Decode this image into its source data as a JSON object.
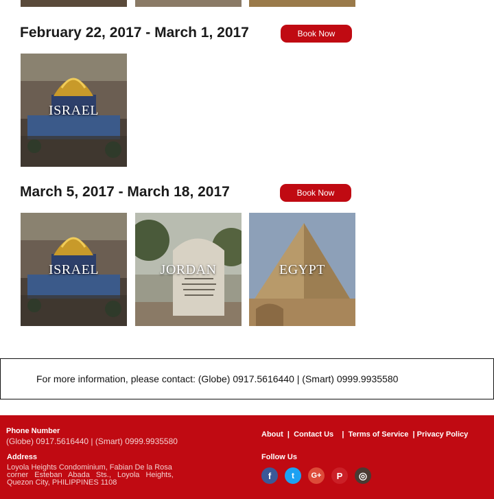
{
  "trips": [
    {
      "dates": "February 22, 2017 - March 1, 2017",
      "button": "Book Now",
      "destinations": [
        "ISRAEL"
      ]
    },
    {
      "dates": "March 5, 2017 - March 18, 2017",
      "button": "Book Now",
      "destinations": [
        "ISRAEL",
        "JORDAN",
        "EGYPT"
      ]
    }
  ],
  "contact": {
    "text": "For more information, please contact: (Globe) 0917.5616440 | (Smart) 0999.9935580"
  },
  "footer": {
    "phone_heading": "Phone Number",
    "phone_text": "(Globe) 0917.5616440 | (Smart) 0999.9935580",
    "address_heading": "Address",
    "address_line1": "Loyola Heights Condominium, Fabian De la Rosa",
    "address_line2": "corner Esteban Abada Sts., Loyola Heights,",
    "address_line3": "Quezon City, PHILIPPINES 1108",
    "links": [
      "About",
      "Contact Us",
      "Terms of Service",
      "Privacy Policy"
    ],
    "follow_heading": "Follow Us",
    "social": [
      {
        "name": "facebook-icon",
        "glyph": "f",
        "color": "#3b5998"
      },
      {
        "name": "twitter-icon",
        "glyph": "t",
        "color": "#1da1f2"
      },
      {
        "name": "google-plus-icon",
        "glyph": "G+",
        "color": "#dd4b39"
      },
      {
        "name": "pinterest-icon",
        "glyph": "P",
        "color": "#cb2027"
      },
      {
        "name": "instagram-icon",
        "glyph": "◎",
        "color": "#4a3a33"
      }
    ]
  },
  "colors": {
    "brand_red": "#c00a12"
  }
}
